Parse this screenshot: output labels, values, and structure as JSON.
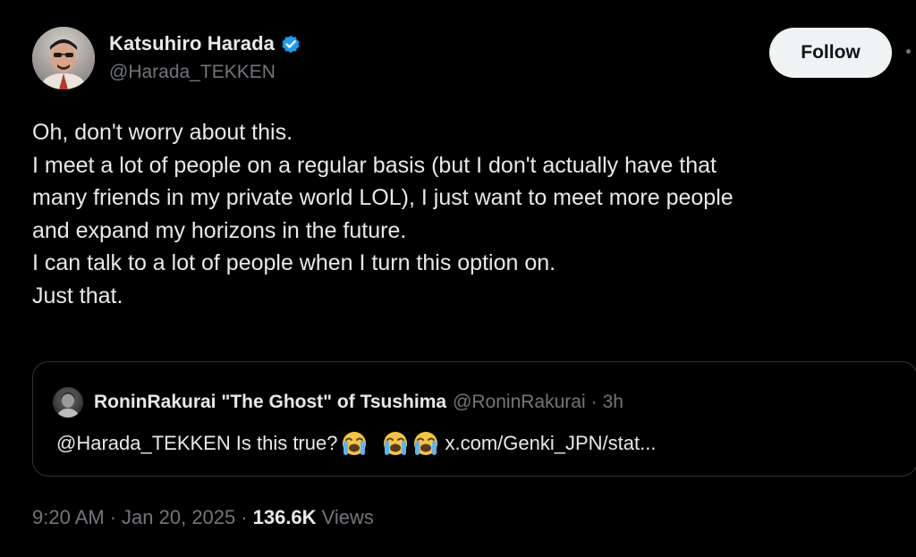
{
  "author": {
    "display_name": "Katsuhiro Harada",
    "handle": "@Harada_TEKKEN",
    "verified": true,
    "avatar_icon": "profile-photo"
  },
  "follow_button": {
    "label": "Follow"
  },
  "more_icon": "more-dots-icon",
  "tweet": {
    "lines": [
      "Oh, don't worry about this.",
      "I meet a lot of people on a regular basis (but I don't actually have that",
      "many friends in my private world LOL), I just want to meet more people",
      "and expand my horizons in the future.",
      "I can talk to a lot of people when I turn this option on.",
      "Just that."
    ]
  },
  "quote": {
    "display_name": "RoninRakurai \"The Ghost\" of Tsushima",
    "handle": "@RoninRakurai",
    "separator": "·",
    "time": "3h",
    "mention": "@Harada_TEKKEN",
    "text": "Is this true?",
    "emoji": "loudly-crying-face",
    "link": "x.com/Genki_JPN/stat..."
  },
  "meta": {
    "time": "9:20 AM",
    "separator": "·",
    "date": "Jan 20, 2025",
    "views_count": "136.6K",
    "views_label": "Views"
  },
  "colors": {
    "background": "#000000",
    "text_primary": "#e7e9ea",
    "text_secondary": "#71767b",
    "border": "#2f3336",
    "verified_blue": "#1d9bf0",
    "follow_bg": "#eff3f4"
  }
}
